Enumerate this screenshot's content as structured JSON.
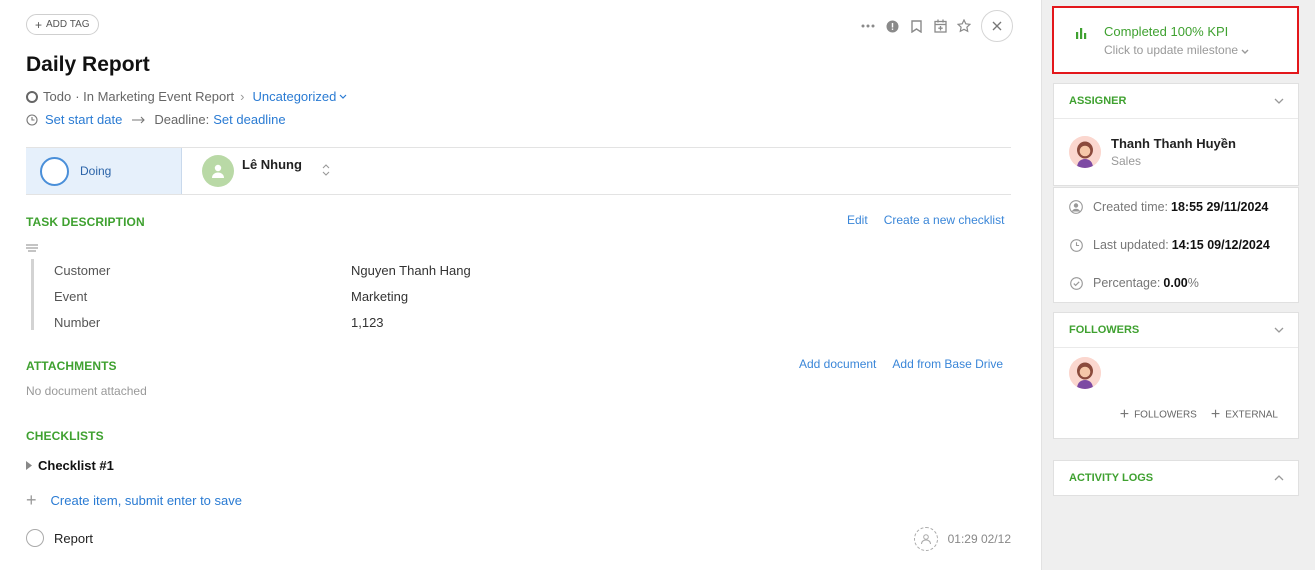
{
  "header": {
    "add_tag": "ADD TAG",
    "title": "Daily Report",
    "status_label": "Todo",
    "breadcrumb": "· In Marketing Event Report",
    "breadcrumb_sep": "›",
    "category": "Uncategorized",
    "set_start": "Set start date",
    "deadline_label": "Deadline:",
    "set_deadline": "Set deadline"
  },
  "status": {
    "current": "Doing",
    "assignee": "Lê Nhung"
  },
  "task_description": {
    "heading": "TASK DESCRIPTION",
    "edit": "Edit",
    "create_checklist": "Create a new checklist",
    "rows": [
      {
        "label": "Customer",
        "value": "Nguyen Thanh Hang"
      },
      {
        "label": "Event",
        "value": "Marketing"
      },
      {
        "label": "Number",
        "value": "1,123"
      }
    ]
  },
  "attachments": {
    "heading": "ATTACHMENTS",
    "add_document": "Add document",
    "add_from_drive": "Add from Base Drive",
    "empty": "No document attached"
  },
  "checklists": {
    "heading": "CHECKLISTS",
    "checklist_name": "Checklist #1",
    "create_item": "Create item, submit enter to save",
    "item": {
      "label": "Report",
      "time": "01:29 02/12"
    }
  },
  "sidebar": {
    "kpi_title": "Completed 100% KPI",
    "kpi_sub": "Click to update milestone",
    "assigner_heading": "ASSIGNER",
    "assigner_name": "Thanh Thanh Huyền",
    "assigner_role": "Sales",
    "created_label": "Created time:",
    "created_value": "18:55 29/11/2024",
    "updated_label": "Last updated:",
    "updated_value": "14:15 09/12/2024",
    "percentage_label": "Percentage:",
    "percentage_value": "0.00",
    "percentage_unit": "%",
    "followers_heading": "FOLLOWERS",
    "followers_btn": "FOLLOWERS",
    "external_btn": "EXTERNAL",
    "activity_heading": "ACTIVITY LOGS"
  },
  "colors": {
    "accent_green": "#3fa130",
    "link_blue": "#2a7bd3",
    "highlight_red": "#e3171b"
  }
}
